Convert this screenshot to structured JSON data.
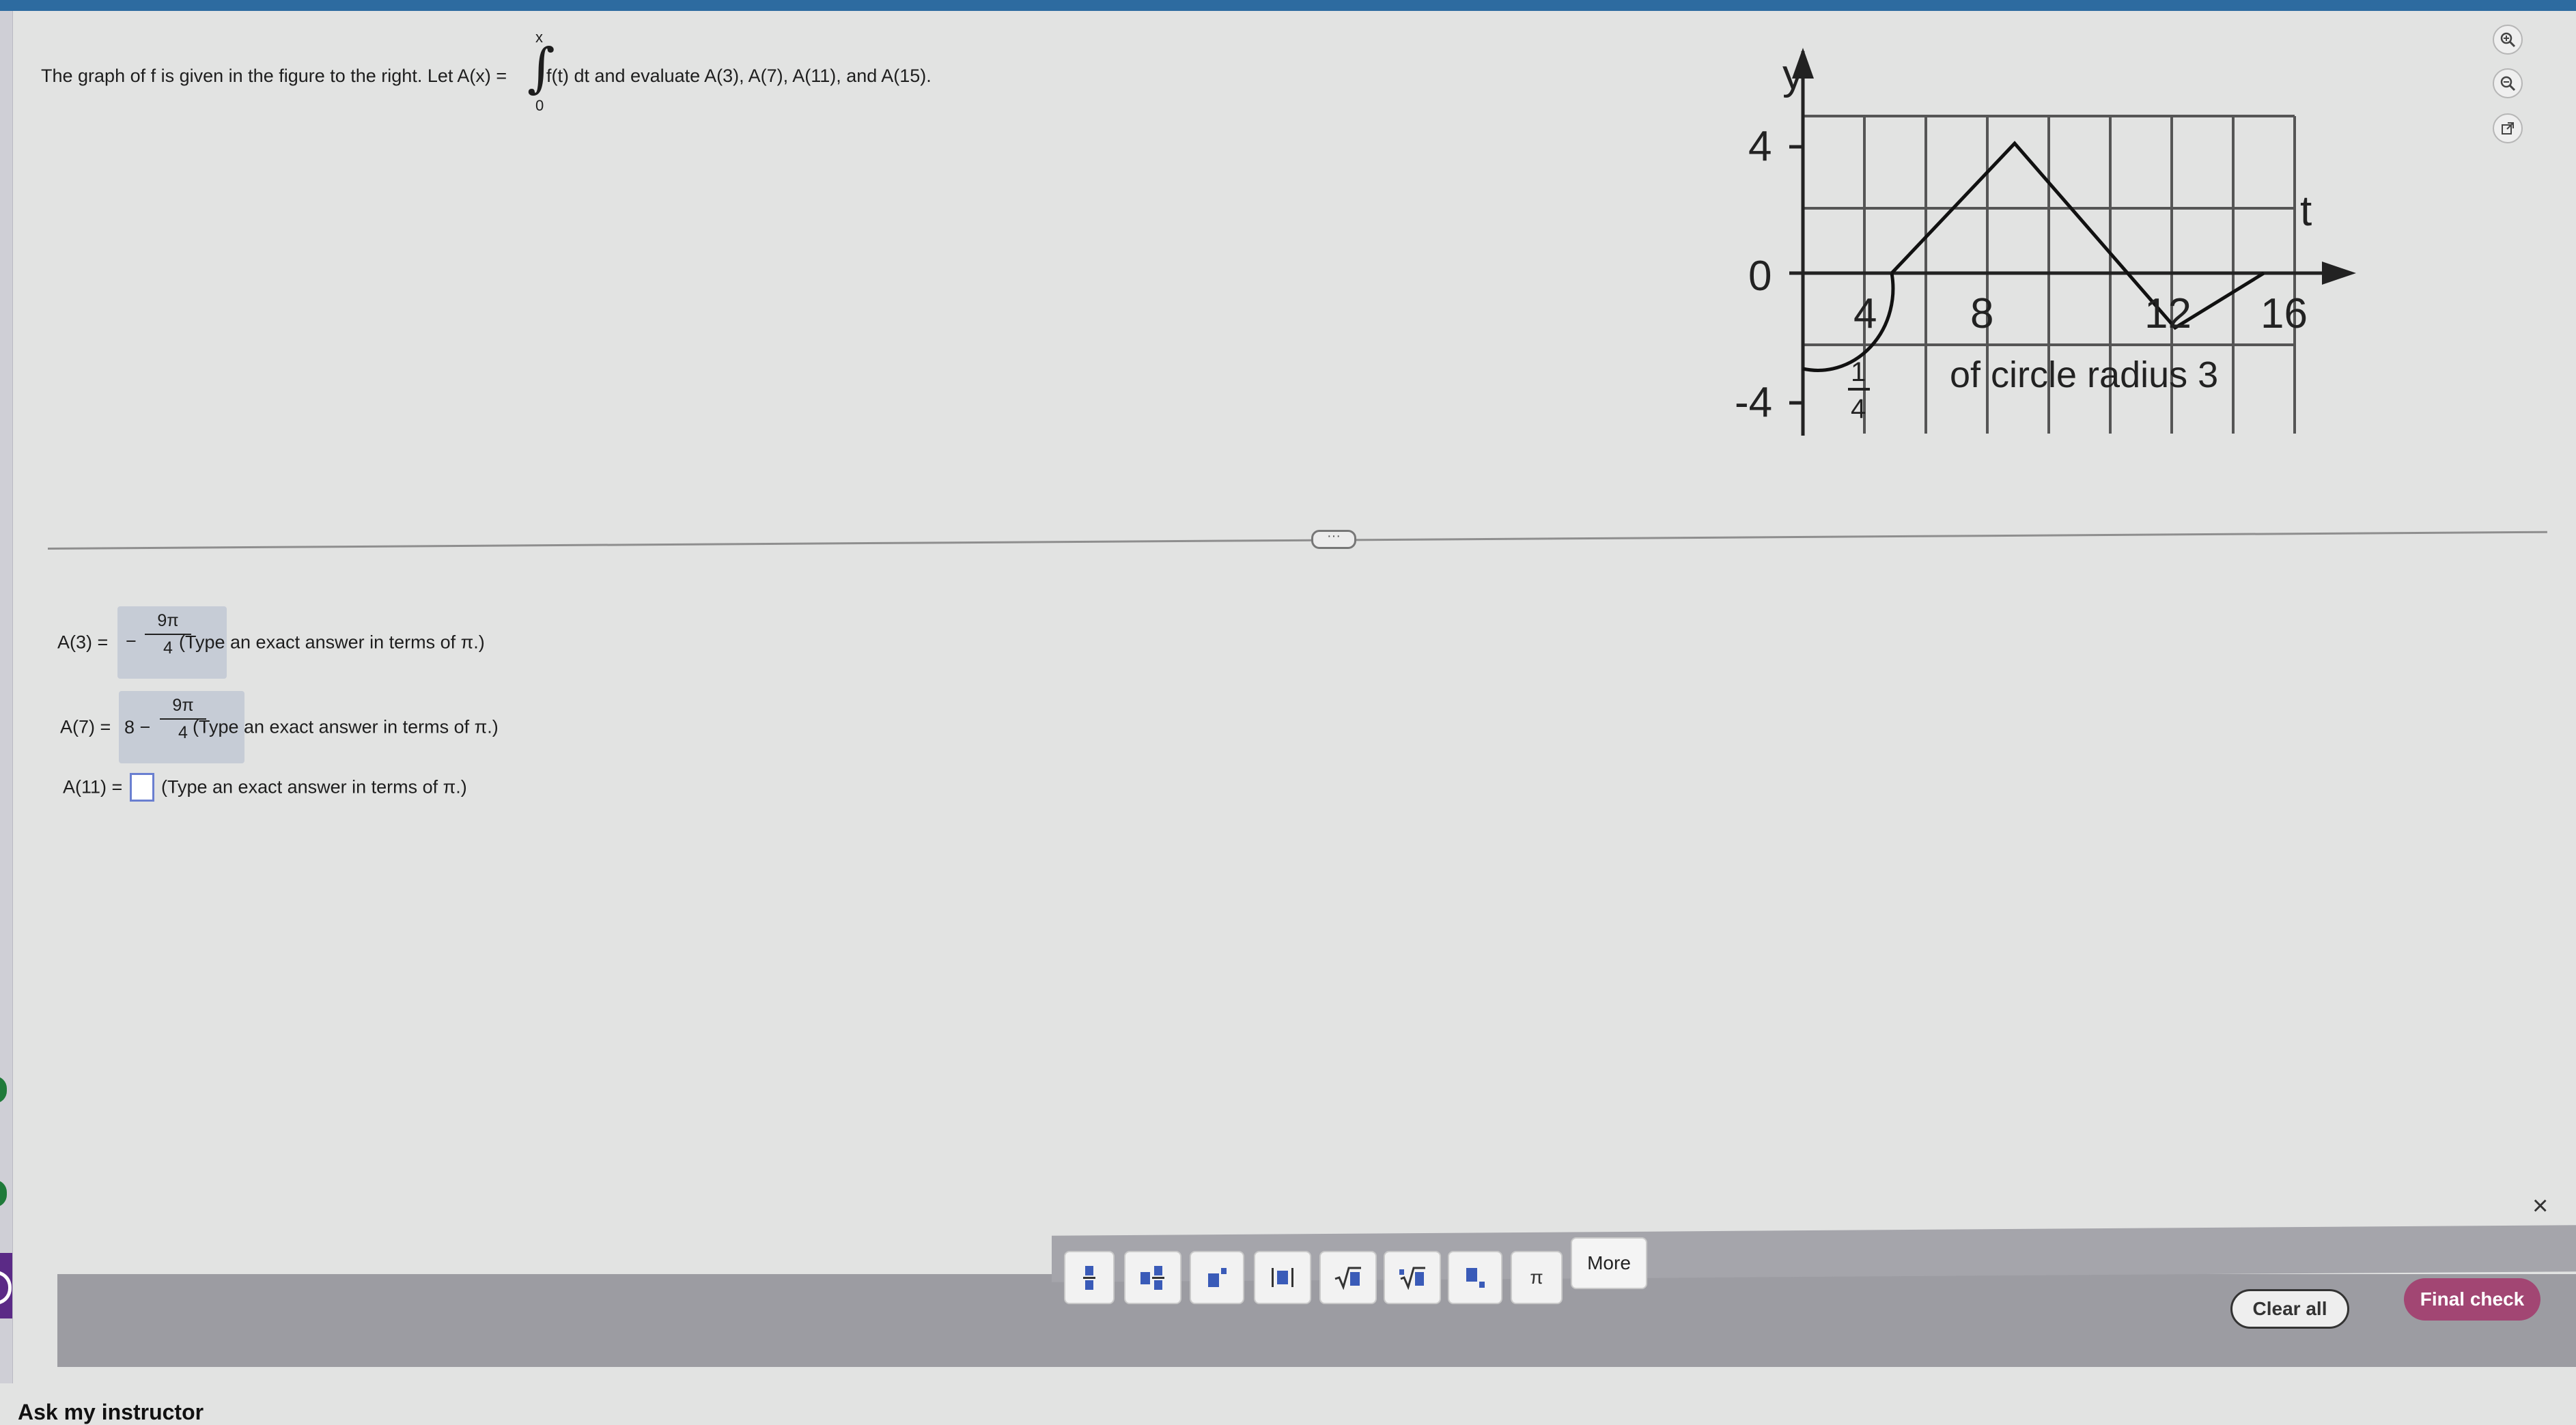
{
  "question": {
    "text_before": "The graph of f is given in the figure to the right. Let A(x) =",
    "integral_upper": "x",
    "integral_sign": "∫",
    "integral_lower": "0",
    "text_after": "f(t) dt and evaluate A(3), A(7), A(11), and A(15)."
  },
  "figure": {
    "y_label": "y",
    "x_label": "t",
    "y_ticks": [
      "4",
      "0",
      "-4"
    ],
    "x_ticks": [
      "4",
      "8",
      "12",
      "16"
    ],
    "annotation": "of circle radius 3",
    "annotation_fraction_num": "1",
    "annotation_fraction_den": "4"
  },
  "answers": [
    {
      "label": "A(3) =",
      "prefix": "−",
      "num": "9π",
      "den": "4",
      "hint": "(Type an exact answer in terms of π.)"
    },
    {
      "label": "A(7) =",
      "prefix": "8 −",
      "num": "9π",
      "den": "4",
      "hint": "(Type an exact answer in terms of π.)"
    },
    {
      "label": "A(11) =",
      "value": "",
      "hint": "(Type an exact answer in terms of π.)"
    }
  ],
  "toolbar": {
    "buttons": [
      "fraction",
      "mixed-number",
      "exponent",
      "absolute-value",
      "square-root",
      "nth-root",
      "subscript",
      "pi"
    ],
    "pi_label": "π",
    "more_label": "More",
    "close_label": "×"
  },
  "actions": {
    "clear_all": "Clear all",
    "final_check": "Final check"
  },
  "footer": {
    "ask_instructor": "Ask my instructor"
  }
}
